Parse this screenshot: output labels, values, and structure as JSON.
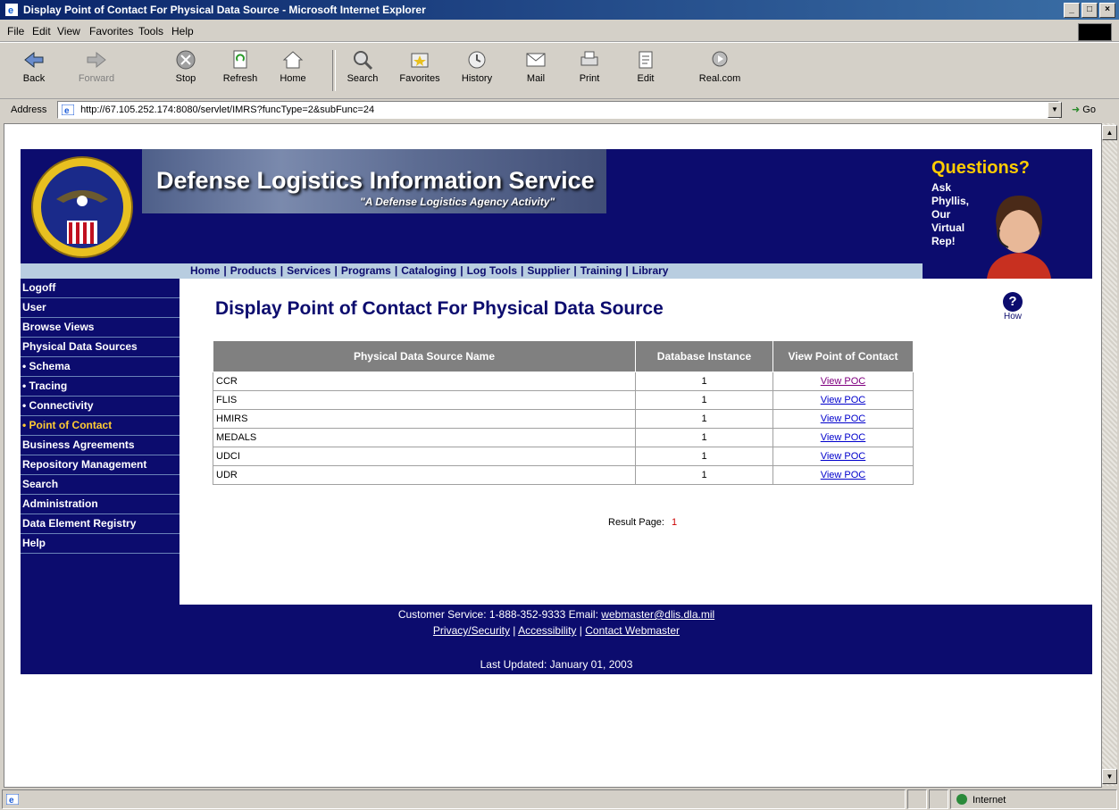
{
  "window": {
    "title": "Display Point of Contact For Physical Data Source - Microsoft Internet Explorer",
    "minimize": "_",
    "maximize": "□",
    "close": "×"
  },
  "menubar": {
    "items": [
      "File",
      "Edit",
      "View",
      "Favorites",
      "Tools",
      "Help"
    ]
  },
  "toolbar": {
    "buttons": [
      "Back",
      "Forward",
      "Stop",
      "Refresh",
      "Home",
      "Search",
      "Favorites",
      "History",
      "Mail",
      "Print",
      "Edit",
      "Real.com"
    ]
  },
  "addressbar": {
    "label": "Address",
    "url": "http://67.105.252.174:8080/servlet/IMRS?funcType=2&subFunc=24",
    "go_label": "Go"
  },
  "statusbar": {
    "zone": "Internet"
  },
  "banner": {
    "title": "Defense Logistics Information Service",
    "subtitle": "\"A Defense Logistics Agency Activity\"",
    "questions_title": "Questions?",
    "questions_text": "Ask Phyllis, Our Virtual Rep!"
  },
  "topnav": {
    "items": [
      "Home",
      "Products",
      "Services",
      "Programs",
      "Cataloging",
      "Log Tools",
      "Supplier",
      "Training",
      "Library"
    ]
  },
  "leftnav": {
    "items": [
      {
        "label": "Logoff",
        "active": false
      },
      {
        "label": "User",
        "active": false
      },
      {
        "label": "Browse Views",
        "active": false
      },
      {
        "label": "Physical Data Sources",
        "active": false
      },
      {
        "label": "• Schema",
        "active": false
      },
      {
        "label": "• Tracing",
        "active": false
      },
      {
        "label": "• Connectivity",
        "active": false
      },
      {
        "label": "• Point of Contact",
        "active": true
      },
      {
        "label": "Business Agreements",
        "active": false
      },
      {
        "label": "Repository Management",
        "active": false
      },
      {
        "label": "Search",
        "active": false
      },
      {
        "label": "Administration",
        "active": false
      },
      {
        "label": "Data Element Registry",
        "active": false
      },
      {
        "label": "Help",
        "active": false
      }
    ]
  },
  "main": {
    "page_title": "Display Point of Contact For Physical Data Source",
    "help_label": "How",
    "table": {
      "headers": [
        "Physical Data Source Name",
        "Database Instance",
        "View Point of Contact"
      ],
      "rows": [
        {
          "name": "CCR",
          "instance": "1",
          "link": "View POC"
        },
        {
          "name": "FLIS",
          "instance": "1",
          "link": "View POC"
        },
        {
          "name": "HMIRS",
          "instance": "1",
          "link": "View POC"
        },
        {
          "name": "MEDALS",
          "instance": "1",
          "link": "View POC"
        },
        {
          "name": "UDCI",
          "instance": "1",
          "link": "View POC"
        },
        {
          "name": "UDR",
          "instance": "1",
          "link": "View POC"
        }
      ]
    },
    "result_page_label": "Result Page:",
    "result_page_num": "1"
  },
  "footer": {
    "customer_service": "Customer Service: 1-888-352-9333 Email:",
    "email": "webmaster@dlis.dla.mil",
    "links": [
      "Privacy/Security",
      "Accessibility",
      "Contact Webmaster"
    ],
    "last_updated": "Last Updated: January 01, 2003"
  },
  "colors": {
    "navy": "#0c0c6e",
    "nav_strip": "#b8cde0",
    "active_nav": "#ffcc33",
    "table_header": "#808080"
  }
}
